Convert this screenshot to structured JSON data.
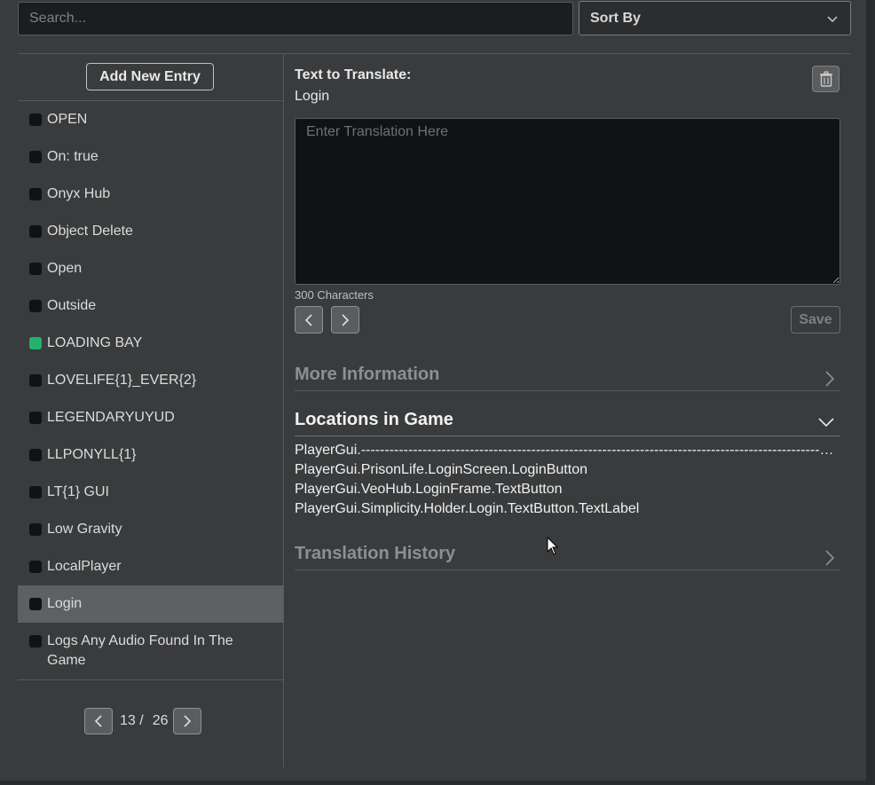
{
  "search": {
    "placeholder": "Search..."
  },
  "sort": {
    "label": "Sort By"
  },
  "left_panel": {
    "add_button": "Add New Entry",
    "entries": [
      {
        "label": "OPEN",
        "status": "none"
      },
      {
        "label": "On: true",
        "status": "none"
      },
      {
        "label": "Onyx Hub",
        "status": "none"
      },
      {
        "label": "Object Delete",
        "status": "none"
      },
      {
        "label": "Open",
        "status": "none"
      },
      {
        "label": "Outside",
        "status": "none"
      },
      {
        "label": "LOADING BAY",
        "status": "translated"
      },
      {
        "label": "LOVELIFE{1}_EVER{2}",
        "status": "none"
      },
      {
        "label": "LEGENDARYUYUD",
        "status": "none"
      },
      {
        "label": "LLPONYLL{1}",
        "status": "none"
      },
      {
        "label": "LT{1} GUI",
        "status": "none"
      },
      {
        "label": "Low Gravity",
        "status": "none"
      },
      {
        "label": "LocalPlayer",
        "status": "none"
      },
      {
        "label": "Login",
        "status": "none",
        "selected": true
      },
      {
        "label": "Logs Any Audio Found In The Game",
        "status": "none"
      }
    ],
    "pager": {
      "current": "13 /",
      "total": "26"
    },
    "status_colors": {
      "translated": "#23b26d",
      "none": "#111213"
    }
  },
  "detail": {
    "text_label": "Text to Translate:",
    "text_value": "Login",
    "translation_placeholder": "Enter Translation Here",
    "char_count": "300 Characters",
    "save_label": "Save",
    "more_info": "More Information",
    "locations_title": "Locations in Game",
    "locations": [
      "PlayerGui.--------------------------------------------------------------------------------------------------------------",
      "PlayerGui.PrisonLife.LoginScreen.LoginButton",
      "PlayerGui.VeoHub.LoginFrame.TextButton",
      "PlayerGui.Simplicity.Holder.Login.TextButton.TextLabel"
    ],
    "history": "Translation History"
  },
  "icons": {
    "sort_chevron": "chevron-down-icon",
    "trash": "trash-icon",
    "prev": "chevron-left-icon",
    "next": "chevron-right-icon"
  }
}
